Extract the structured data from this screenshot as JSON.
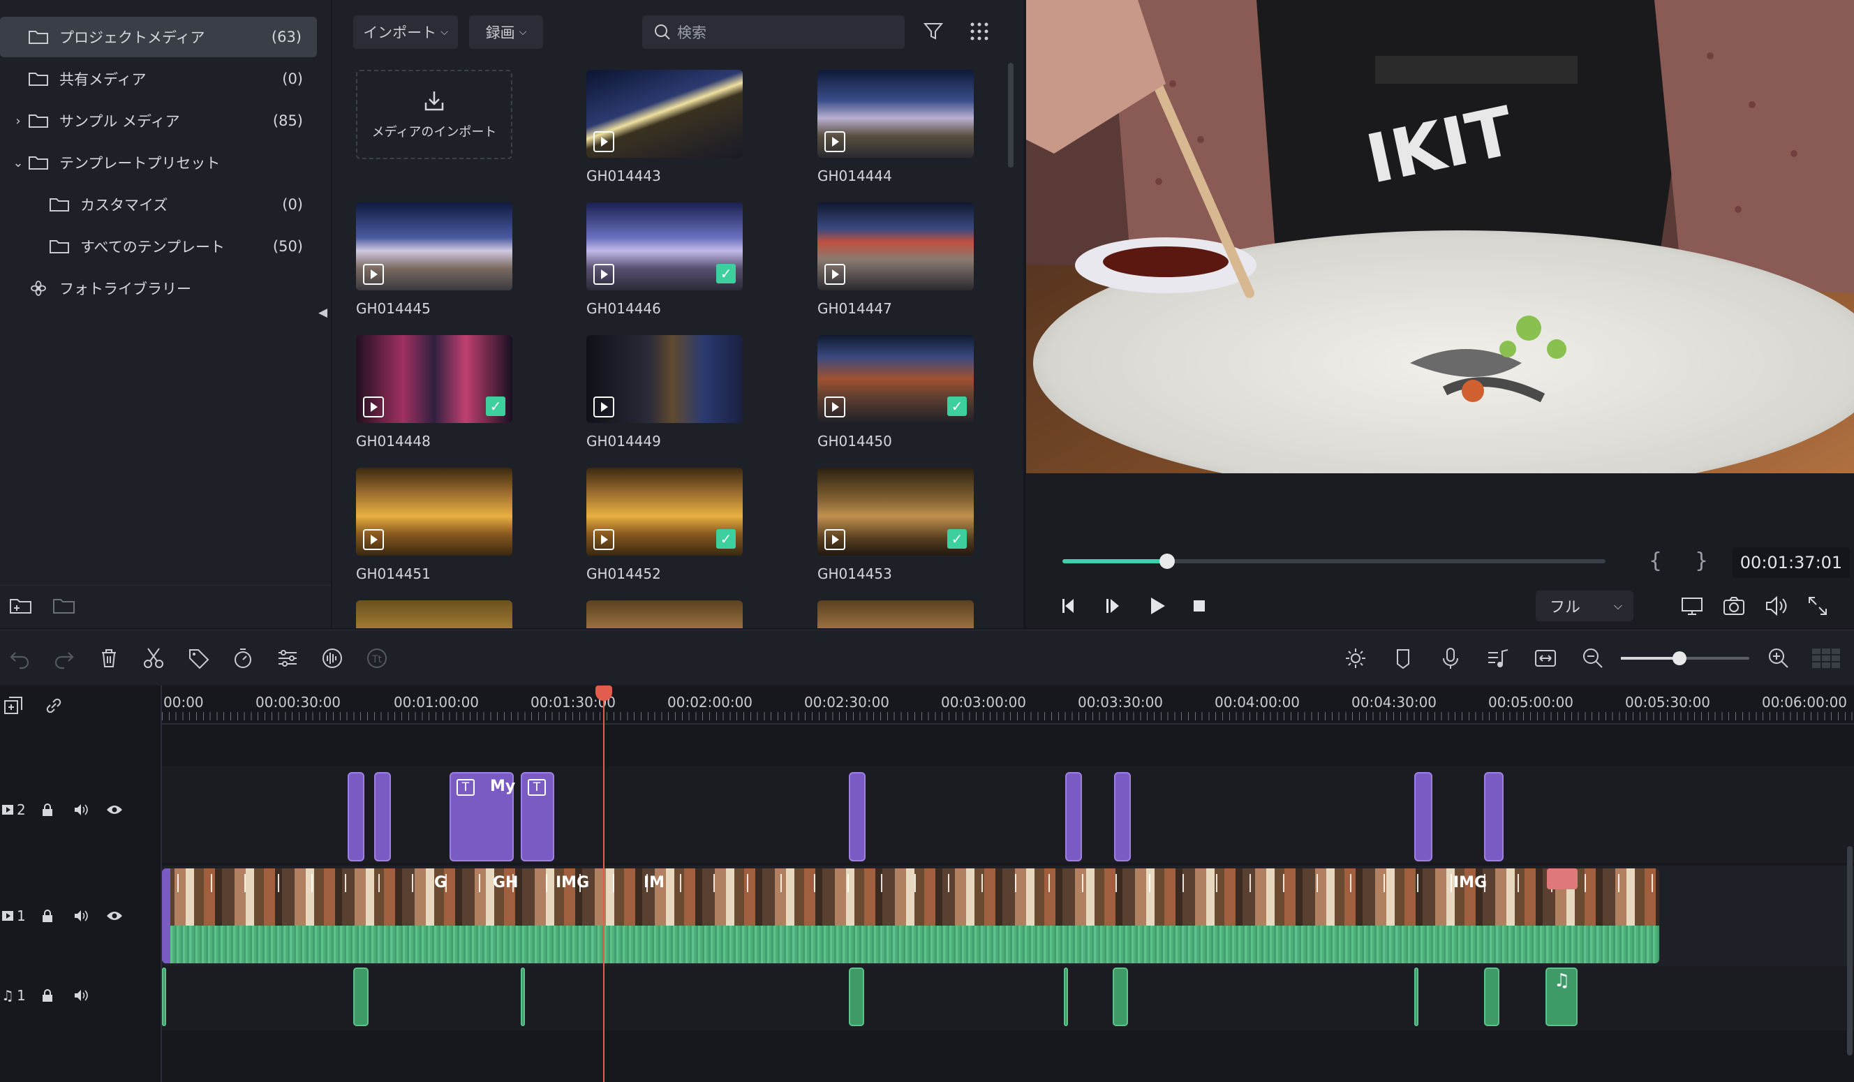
{
  "sidebar": {
    "items": [
      {
        "label": "プロジェクトメディア",
        "count": "(63)",
        "chevron": ""
      },
      {
        "label": "共有メディア",
        "count": "(0)",
        "chevron": ""
      },
      {
        "label": "サンプル メディア",
        "count": "(85)",
        "chevron": "›"
      },
      {
        "label": "テンプレートプリセット",
        "count": "",
        "chevron": "⌄"
      },
      {
        "label": "カスタマイズ",
        "count": "(0)",
        "chevron": ""
      },
      {
        "label": "すべてのテンプレート",
        "count": "(50)",
        "chevron": ""
      },
      {
        "label": "フォトライブラリー",
        "count": "",
        "chevron": ""
      }
    ],
    "collapse_glyph": "◀"
  },
  "media": {
    "import_dropdown": "インポート",
    "record_dropdown": "録画",
    "search_placeholder": "検索",
    "import_tile_label": "メディアのインポート",
    "tiles": [
      {
        "name": "GH014443",
        "checked": false
      },
      {
        "name": "GH014444",
        "checked": false
      },
      {
        "name": "GH014445",
        "checked": false
      },
      {
        "name": "GH014446",
        "checked": true
      },
      {
        "name": "GH014447",
        "checked": false
      },
      {
        "name": "GH014448",
        "checked": true
      },
      {
        "name": "GH014449",
        "checked": false
      },
      {
        "name": "GH014450",
        "checked": true
      },
      {
        "name": "GH014451",
        "checked": false
      },
      {
        "name": "GH014452",
        "checked": true
      },
      {
        "name": "GH014453",
        "checked": true
      }
    ]
  },
  "preview": {
    "timecode": "00:01:37:01",
    "progress": 0.193,
    "quality": "フル",
    "brace_open": "{",
    "brace_close": "}"
  },
  "timeline": {
    "ruler": [
      "00:00",
      "00:00:30:00",
      "00:01:00:00",
      "00:01:30:00",
      "00:02:00:00",
      "00:02:30:00",
      "00:03:00:00",
      "00:03:30:00",
      "00:04:00:00",
      "00:04:30:00",
      "00:05:00:00",
      "00:05:30:00",
      "00:06:00:00"
    ],
    "tracks": {
      "v2": "2",
      "v1": "1",
      "a1": "1"
    },
    "title_clip_label": "My",
    "video_clip_labels": [
      "G",
      "GH",
      "IMG",
      "IM",
      "IMG"
    ]
  },
  "colors": {
    "accent": "#3ecfae",
    "title_clip": "#7a5bc4",
    "audio_clip": "#3e9a67",
    "playhead": "#e35d4e"
  }
}
